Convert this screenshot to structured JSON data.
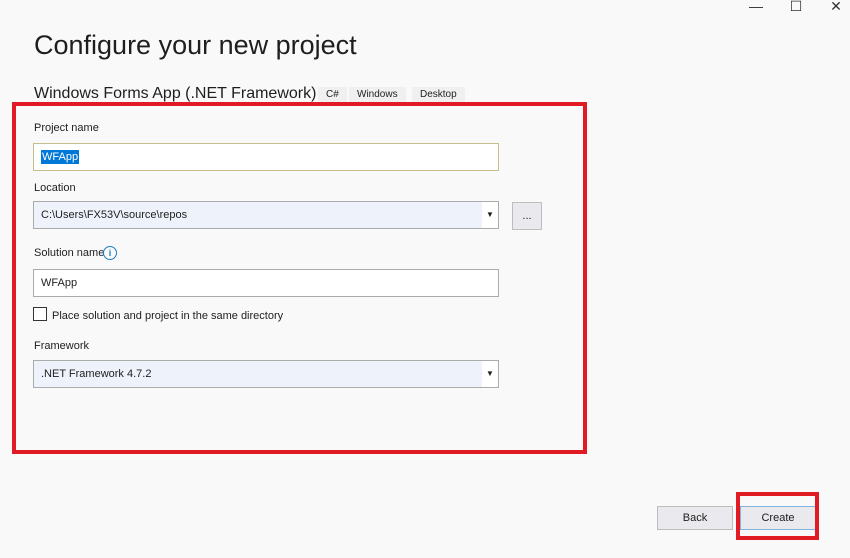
{
  "window": {
    "minimize_icon": "—",
    "maximize_icon": "☐",
    "close_icon": "✕"
  },
  "header": {
    "title": "Configure your new project",
    "template_name": "Windows Forms App (.NET Framework)",
    "tags": [
      "C#",
      "Windows",
      "Desktop"
    ]
  },
  "form": {
    "project_name_label": "Project name",
    "project_name_value": "WFApp",
    "location_label": "Location",
    "location_value": "C:\\Users\\FX53V\\source\\repos",
    "browse_label": "...",
    "solution_name_label": "Solution name",
    "solution_name_value": "WFApp",
    "info_icon": "i",
    "same_dir_label": "Place solution and project in the same directory",
    "same_dir_checked": false,
    "framework_label": "Framework",
    "framework_value": ".NET Framework 4.7.2"
  },
  "footer": {
    "back_label": "Back",
    "create_label": "Create"
  },
  "colors": {
    "highlight": "#e01b24",
    "selection": "#0078d7"
  }
}
